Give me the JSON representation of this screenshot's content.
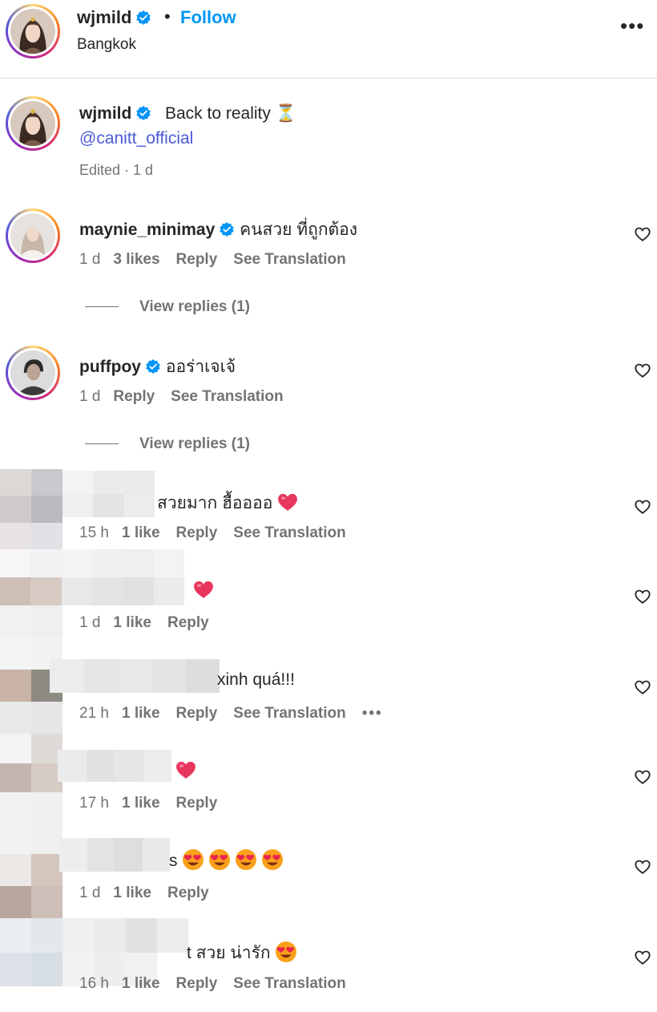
{
  "header": {
    "username": "wjmild",
    "separator": "•",
    "follow_label": "Follow",
    "location": "Bangkok",
    "more_label": "•••"
  },
  "caption": {
    "username": "wjmild",
    "text": "Back to reality ⏳",
    "mention": "@canitt_official",
    "meta": "Edited · 1 d"
  },
  "comments": [
    {
      "username": "maynie_minimay",
      "text": "คนสวย ที่ถูกต้อง",
      "time": "1 d",
      "likes": "3 likes",
      "reply": "Reply",
      "translate": "See Translation",
      "view_replies": "View replies (1)"
    },
    {
      "username": "puffpoy",
      "text": "ออร่าเจเจ้",
      "time": "1 d",
      "reply": "Reply",
      "translate": "See Translation",
      "view_replies": "View replies (1)"
    },
    {
      "text": "สวยมาก ฮื้ออออ",
      "time": "15 h",
      "likes": "1 like",
      "reply": "Reply",
      "translate": "See Translation"
    },
    {
      "text": "",
      "time": "1 d",
      "likes": "1 like",
      "reply": "Reply"
    },
    {
      "text": "xinh quá!!!",
      "time": "21 h",
      "likes": "1 like",
      "reply": "Reply",
      "translate": "See Translation",
      "more": "•••"
    },
    {
      "text": "",
      "time": "17 h",
      "likes": "1 like",
      "reply": "Reply"
    },
    {
      "text": "s",
      "time": "1 d",
      "likes": "1 like",
      "reply": "Reply"
    },
    {
      "text": "t สวย น่ารัก",
      "time": "16 h",
      "likes": "1 like",
      "reply": "Reply",
      "translate": "See Translation"
    }
  ],
  "colors": {
    "follow": "#0095f6",
    "mention": "#4a5bd6",
    "verified": "#0095f6",
    "muted": "#737373",
    "heart_emoji": "#e8375f"
  },
  "icons": [
    "verified-badge-icon",
    "more-options-icon",
    "heart-outline-icon",
    "red-heart-emoji",
    "heart-eyes-emoji",
    "hourglass-emoji"
  ]
}
